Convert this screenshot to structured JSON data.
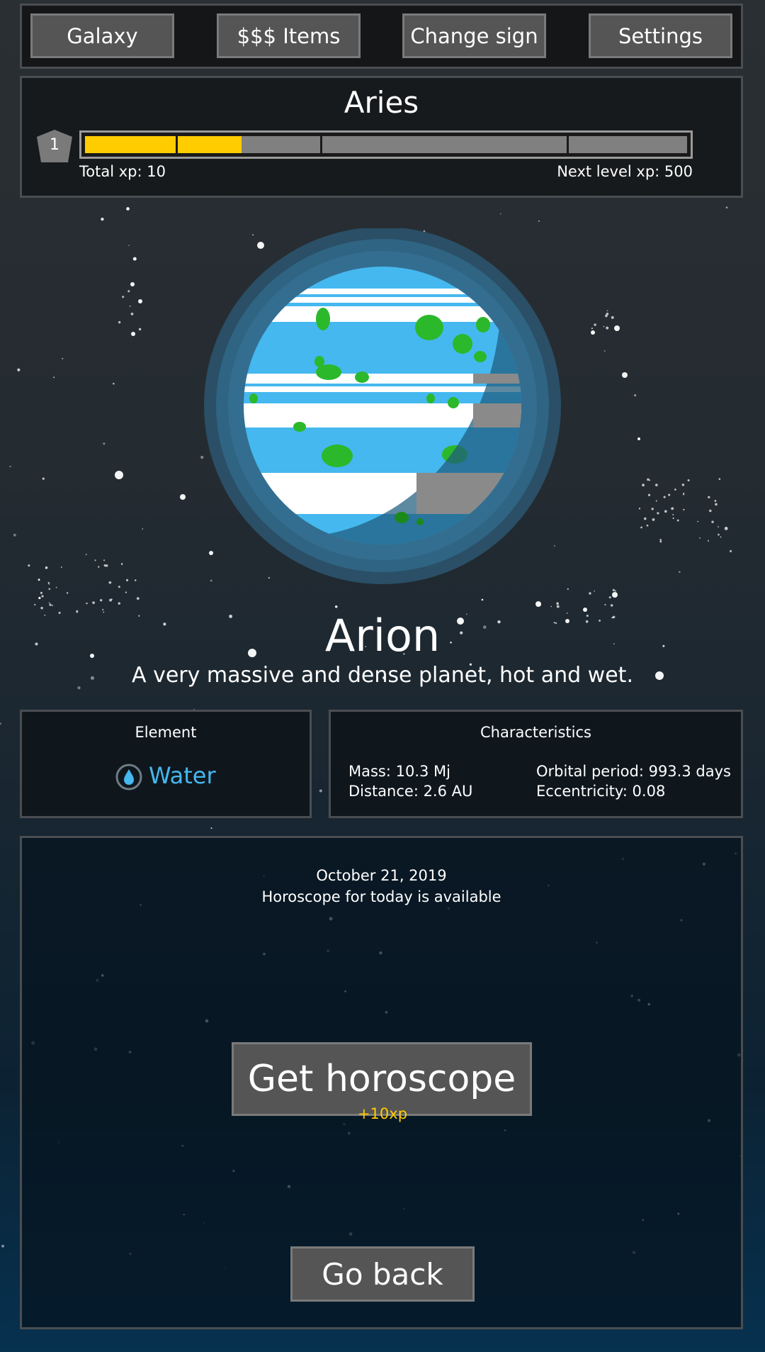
{
  "nav": {
    "galaxy_label": "Galaxy",
    "items_label": "$$$ Items",
    "change_sign_label": "Change sign",
    "settings_label": "Settings"
  },
  "sign": {
    "name": "Aries",
    "level": "1",
    "xp_progress_fraction": 0.26,
    "total_xp_label": "Total xp: 10",
    "next_level_label": "Next level xp: 500"
  },
  "planet": {
    "name": "Arion",
    "description": "A very massive and dense planet, hot and wet."
  },
  "element": {
    "heading": "Element",
    "value": "Water",
    "icon": "water-drop-icon",
    "color": "#45b8ef"
  },
  "characteristics": {
    "heading": "Characteristics",
    "mass": "Mass: 10.3 Mj",
    "distance": "Distance: 2.6 AU",
    "orbital_period": "Orbital period: 993.3 days",
    "eccentricity": "Eccentricity: 0.08"
  },
  "horoscope": {
    "date": "October 21, 2019",
    "status": "Horoscope for today is available",
    "button_label": "Get horoscope",
    "xp_reward": "+10xp"
  },
  "footer": {
    "back_label": "Go back"
  },
  "colors": {
    "xp_fill": "#ffcc00",
    "xp_empty": "#808080",
    "button_bg": "#555555"
  }
}
